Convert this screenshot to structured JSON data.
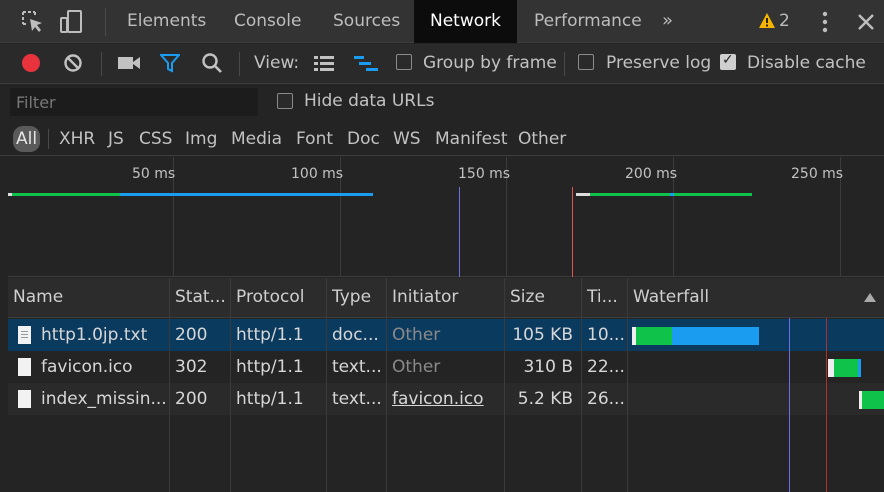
{
  "tabs": {
    "items": [
      "Elements",
      "Console",
      "Sources",
      "Network",
      "Performance"
    ],
    "active": "Network",
    "more": "»",
    "warning_count": "2"
  },
  "toolbar": {
    "view_label": "View:",
    "group_by_frame": "Group by frame",
    "group_by_frame_checked": false,
    "preserve_log": "Preserve log",
    "preserve_log_checked": false,
    "disable_cache": "Disable cache",
    "disable_cache_checked": true
  },
  "filter": {
    "placeholder": "Filter",
    "value": "",
    "hide_data_urls": "Hide data URLs",
    "hide_data_urls_checked": false
  },
  "type_filters": [
    "All",
    "XHR",
    "JS",
    "CSS",
    "Img",
    "Media",
    "Font",
    "Doc",
    "WS",
    "Manifest",
    "Other"
  ],
  "type_filter_active": "All",
  "overview": {
    "ticks": [
      "50 ms",
      "100 ms",
      "150 ms",
      "200 ms",
      "250 ms"
    ]
  },
  "table": {
    "columns": [
      "Name",
      "Stat...",
      "Protocol",
      "Type",
      "Initiator",
      "Size",
      "Ti...",
      "Waterfall"
    ],
    "rows": [
      {
        "name": "http1.0jp.txt",
        "status": "200",
        "protocol": "http/1.1",
        "type": "doc...",
        "initiator": "Other",
        "size": "105 KB",
        "time": "10..."
      },
      {
        "name": "favicon.ico",
        "status": "302",
        "protocol": "http/1.1",
        "type": "text...",
        "initiator": "Other",
        "size": "310 B",
        "time": "22..."
      },
      {
        "name": "index_missin...",
        "status": "200",
        "protocol": "http/1.1",
        "type": "text...",
        "initiator": "favicon.ico",
        "size": "5.2 KB",
        "time": "26..."
      }
    ]
  },
  "colors": {
    "accent_blue": "#1a9cf0",
    "waiting_green": "#0ec24a",
    "record_red": "#e8333c",
    "dom_content_line": "#6e6ee6",
    "load_line": "#e05555",
    "selected_row": "#0b3a5f"
  }
}
